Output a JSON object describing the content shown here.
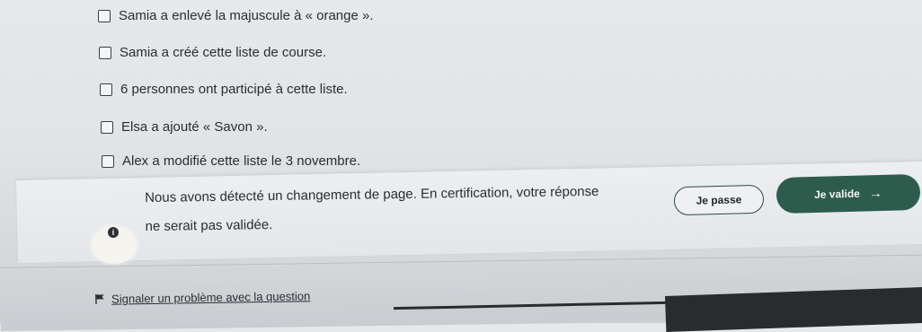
{
  "options": [
    {
      "label": "Samia a enlevé la majuscule à « orange »."
    },
    {
      "label": "Samia a créé cette liste de course."
    },
    {
      "label": "6 personnes ont participé à cette liste."
    },
    {
      "label": "Elsa a ajouté « Savon »."
    },
    {
      "label": "Alex a modifié cette liste le 3 novembre."
    }
  ],
  "warning": {
    "line1": "Nous avons détecté un changement de page. En certification, votre réponse",
    "line2": "ne serait pas validée.",
    "icon": "info-icon"
  },
  "buttons": {
    "skip_label": "Je passe",
    "validate_label": "Je valide",
    "validate_icon": "arrow-right-icon"
  },
  "footer": {
    "report_label": "Signaler un problème avec la question",
    "report_icon": "flag-icon"
  },
  "colors": {
    "primary": "#2d5c4c",
    "text": "#2a2d31",
    "background": "#e4e7ea"
  }
}
